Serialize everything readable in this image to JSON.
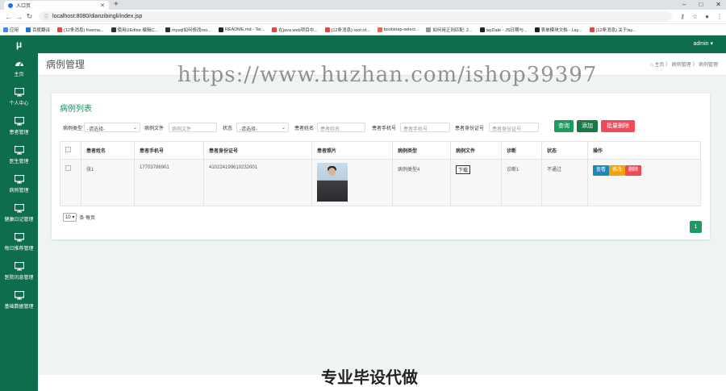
{
  "browser": {
    "tab_title": "入口页",
    "url": "localhost:8080/dianzibingli/index.jsp",
    "bookmarks": [
      "应用",
      "百度翻译",
      "(12条消息) freema...",
      "使用UEditor 编辑C...",
      "mysql如何修改roo...",
      "README.md - Ter...",
      "在java web项目中...",
      "(12条消息) root of...",
      "bootstrap-select...",
      "如何用正则匹配: 2...",
      "layDate - JS日期与...",
      "表单模块文档 - Lay...",
      "(12条消息) 关于lay..."
    ]
  },
  "app": {
    "logo": "μ",
    "user": "admin ▾",
    "sidebar": [
      {
        "label": "主页",
        "icon": "dashboard-icon"
      },
      {
        "label": "个人中心",
        "icon": "monitor-icon"
      },
      {
        "label": "患者管理",
        "icon": "monitor-icon"
      },
      {
        "label": "医生管理",
        "icon": "monitor-icon"
      },
      {
        "label": "病例管理",
        "icon": "monitor-icon"
      },
      {
        "label": "健康日记管理",
        "icon": "monitor-icon"
      },
      {
        "label": "每日推荐管理",
        "icon": "monitor-icon"
      },
      {
        "label": "医院讯息管理",
        "icon": "monitor-icon"
      },
      {
        "label": "基础数据管理",
        "icon": "monitor-icon"
      }
    ],
    "page_title": "病例管理",
    "breadcrumb": "⌂ 主页  〉 病例管理  〉 病例管理",
    "panel_title": "病例列表",
    "filters": {
      "type_label": "病例类型",
      "type_value": "-请选择-",
      "file_label": "病例文件",
      "file_placeholder": "病例文件",
      "status_label": "状态",
      "status_value": "-请选择-",
      "name_label": "患者姓名",
      "name_placeholder": "患者姓名",
      "phone_label": "患者手机号",
      "phone_placeholder": "患者手机号",
      "id_label": "患者身份证号",
      "id_placeholder": "患者身份证号"
    },
    "buttons": {
      "search": "查询",
      "add": "添加",
      "batch_delete": "批量删除"
    },
    "table": {
      "headers": [
        "患者姓名",
        "患者手机号",
        "患者身份证号",
        "患者照片",
        "病例类型",
        "病例文件",
        "诊断",
        "状态",
        "操作"
      ],
      "rows": [
        {
          "name": "张1",
          "phone": "17703786901",
          "id_card": "410224199610232001",
          "case_type": "病例类型4",
          "file": "下载",
          "diagnosis": "诊断1",
          "status": "不通过",
          "actions": {
            "view": "查看",
            "edit": "修改",
            "delete": "删除"
          }
        }
      ]
    },
    "page_size": "10 ▾",
    "page_size_suffix": "条 每页",
    "current_page": "1"
  },
  "overlay": {
    "watermark": "https://www.huzhan.com/ishop39397",
    "banner": "专业毕设代做"
  }
}
